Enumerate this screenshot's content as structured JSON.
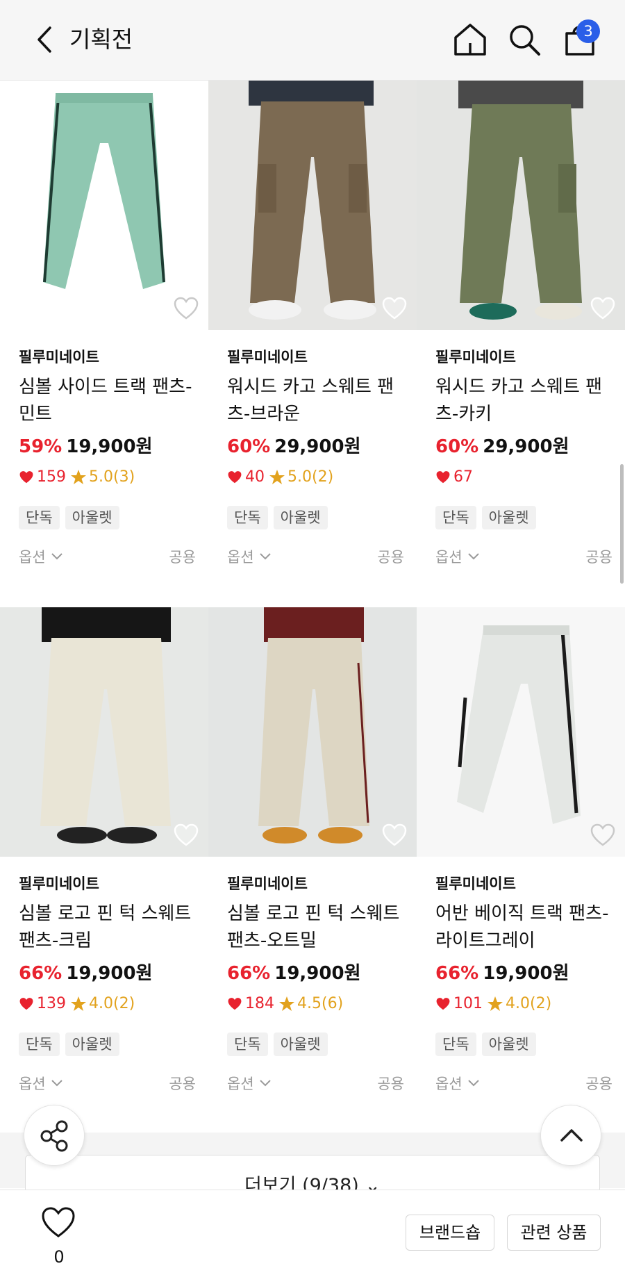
{
  "header": {
    "title": "기획전",
    "cart_count": "3"
  },
  "colors": {
    "accent_red": "#e8222e",
    "rating_orange": "#e2a21d",
    "badge_blue": "#2a5ee8"
  },
  "products": [
    {
      "brand": "필루미네이트",
      "name": "심볼 사이드 트랙 팬츠-민트",
      "discount": "59%",
      "price": "19,900원",
      "likes": "159",
      "rating": "5.0(3)",
      "tags": [
        "단독",
        "아울렛"
      ],
      "option_label": "옵션",
      "gender": "공용",
      "image_color": "#8fc7b1"
    },
    {
      "brand": "필루미네이트",
      "name": "워시드 카고 스웨트 팬츠-브라운",
      "discount": "60%",
      "price": "29,900원",
      "likes": "40",
      "rating": "5.0(2)",
      "tags": [
        "단독",
        "아울렛"
      ],
      "option_label": "옵션",
      "gender": "공용",
      "image_color": "#7c6a52"
    },
    {
      "brand": "필루미네이트",
      "name": "워시드 카고 스웨트 팬츠-카키",
      "discount": "60%",
      "price": "29,900원",
      "likes": "67",
      "rating": "",
      "tags": [
        "단독",
        "아울렛"
      ],
      "option_label": "옵션",
      "gender": "공용",
      "image_color": "#6f7a57"
    },
    {
      "brand": "필루미네이트",
      "name": "심볼 로고 핀 턱 스웨트 팬츠-크림",
      "discount": "66%",
      "price": "19,900원",
      "likes": "139",
      "rating": "4.0(2)",
      "tags": [
        "단독",
        "아울렛"
      ],
      "option_label": "옵션",
      "gender": "공용",
      "image_color": "#e9e5d6"
    },
    {
      "brand": "필루미네이트",
      "name": "심볼 로고 핀 턱 스웨트 팬츠-오트밀",
      "discount": "66%",
      "price": "19,900원",
      "likes": "184",
      "rating": "4.5(6)",
      "tags": [
        "단독",
        "아울렛"
      ],
      "option_label": "옵션",
      "gender": "공용",
      "image_color": "#ddd6c3"
    },
    {
      "brand": "필루미네이트",
      "name": "어반 베이직 트랙 팬츠-라이트그레이",
      "discount": "66%",
      "price": "19,900원",
      "likes": "101",
      "rating": "4.0(2)",
      "tags": [
        "단독",
        "아울렛"
      ],
      "option_label": "옵션",
      "gender": "공용",
      "image_color": "#e4e7e4"
    }
  ],
  "more": {
    "label": "더보기 (9/38)"
  },
  "bottom_bar": {
    "fav_count": "0",
    "brand_shop": "브랜드숍",
    "related": "관련 상품"
  }
}
